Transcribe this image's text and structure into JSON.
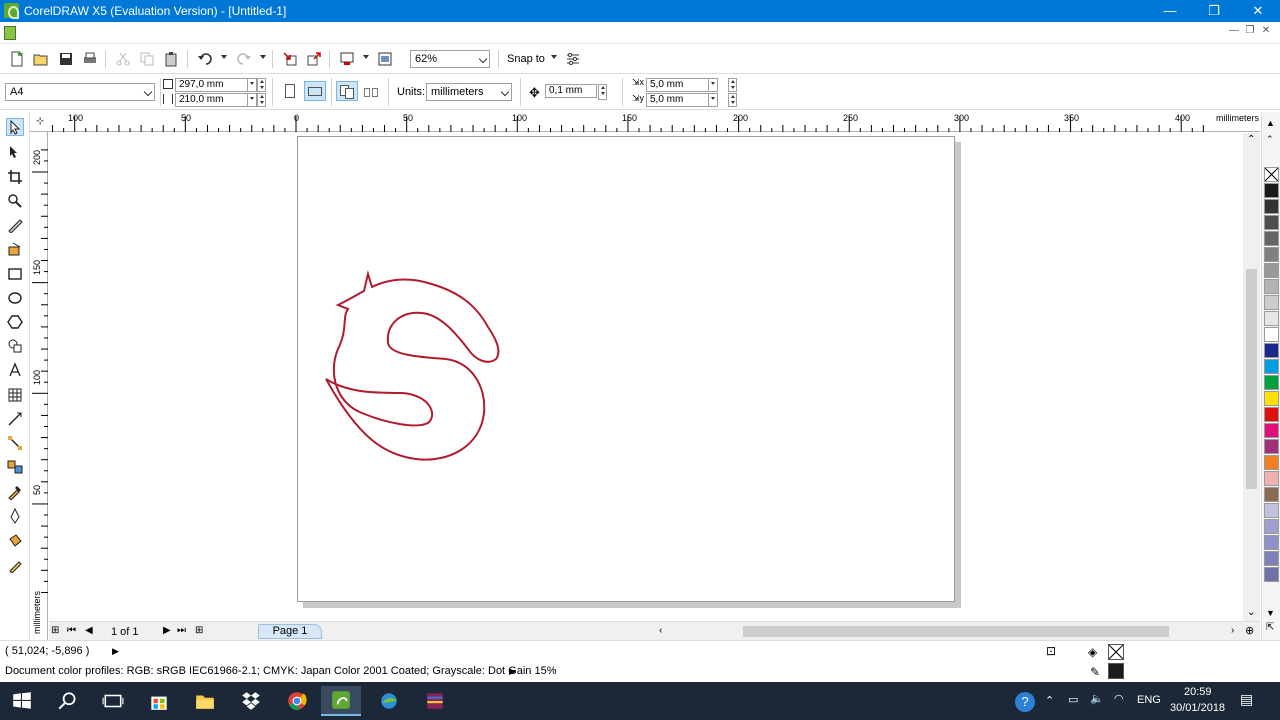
{
  "window": {
    "title": "CorelDRAW X5 (Evaluation Version) - [Untitled-1]",
    "minimize": "—",
    "restore": "❐",
    "close": "✕"
  },
  "toolbar": {
    "zoom_value": "62%",
    "snap_to_label": "Snap to"
  },
  "property_bar": {
    "paper_size": "A4",
    "width": "297,0 mm",
    "height": "210,0 mm",
    "units_label": "Units:",
    "units_value": "millimeters",
    "nudge": "0,1 mm",
    "duplicate_x": "5,0 mm",
    "duplicate_y": "5,0 mm"
  },
  "ruler": {
    "horizontal_labels": [
      "100",
      "50",
      "0",
      "50",
      "100",
      "150",
      "200",
      "250",
      "300",
      "350",
      "400"
    ],
    "horizontal_unit": "millimeters",
    "vertical_labels": [
      "200",
      "150",
      "100",
      "50"
    ],
    "vertical_unit": "millimeters"
  },
  "page_nav": {
    "page_count": "1 of 1",
    "page_tab": "Page 1"
  },
  "status": {
    "coordinates": "( 51,024; -5,896 )",
    "color_profiles": "Document color profiles: RGB: sRGB IEC61966-2.1; CMYK: Japan Color 2001 Coated; Grayscale: Dot Gain 15%"
  },
  "palette": {
    "colors": [
      "#1a1a1a",
      "#333333",
      "#4d4d4d",
      "#666666",
      "#808080",
      "#999999",
      "#b3b3b3",
      "#cccccc",
      "#e6e6e6",
      "#ffffff",
      "#1a2a8c",
      "#00a0e0",
      "#00a040",
      "#ffe000",
      "#e01010",
      "#e0107a",
      "#a0307a",
      "#f08020",
      "#f0b0b0",
      "#8a6a50",
      "#c0c0e0",
      "#a0a0d0",
      "#9090c8",
      "#8080b8",
      "#7070a8"
    ]
  },
  "drawing": {
    "stroke_color": "#b01c2e"
  },
  "taskbar": {
    "language": "ENG",
    "time": "20:59",
    "date": "30/01/2018"
  }
}
